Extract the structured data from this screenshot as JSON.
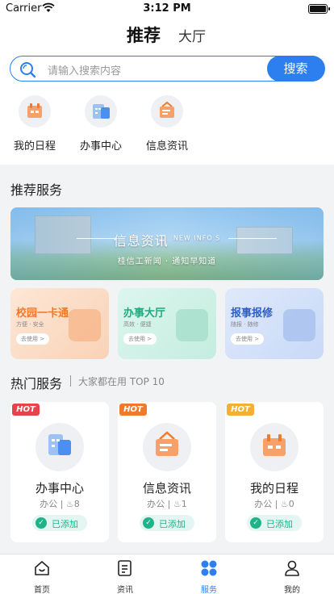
{
  "status": {
    "carrier": "Carrier",
    "time": "3:12 PM"
  },
  "header": {
    "tab_active": "推荐",
    "tab_inactive": "大厅"
  },
  "search": {
    "placeholder": "请输入搜索内容",
    "button": "搜索"
  },
  "quick_links": [
    {
      "label": "我的日程",
      "icon": "calendar-icon"
    },
    {
      "label": "办事中心",
      "icon": "building-icon"
    },
    {
      "label": "信息资讯",
      "icon": "news-icon"
    }
  ],
  "recommend": {
    "title": "推荐服务",
    "banner": {
      "title": "信息资讯",
      "title_badge": "NEW INFO S",
      "subtitle": "桂信工新闻 · 通知早知道"
    },
    "cards": [
      {
        "title": "校园一卡通",
        "subtitle": "方便 · 安全",
        "button": "去使用 >"
      },
      {
        "title": "办事大厅",
        "subtitle": "高效 · 便捷",
        "button": "去使用 >"
      },
      {
        "title": "报事报修",
        "subtitle": "随报 · 随修",
        "button": "去使用 >"
      }
    ]
  },
  "hot": {
    "title": "热门服务",
    "subtitle": "大家都在用 TOP 10",
    "badge_label": "HOT",
    "badge_colors": [
      "#e8434b",
      "#f07a2c",
      "#f2b134"
    ],
    "items": [
      {
        "name": "办事中心",
        "category": "办公",
        "count": "8",
        "status": "已添加",
        "icon": "building-icon"
      },
      {
        "name": "信息资讯",
        "category": "办公",
        "count": "1",
        "status": "已添加",
        "icon": "news-icon"
      },
      {
        "name": "我的日程",
        "category": "办公",
        "count": "0",
        "status": "已添加",
        "icon": "calendar-icon"
      }
    ]
  },
  "tabbar": [
    {
      "label": "首页",
      "icon": "home-icon",
      "active": false
    },
    {
      "label": "资讯",
      "icon": "document-icon",
      "active": false
    },
    {
      "label": "服务",
      "icon": "grid-icon",
      "active": true
    },
    {
      "label": "我的",
      "icon": "person-icon",
      "active": false
    }
  ],
  "colors": {
    "accent": "#2d7ff0",
    "added": "#1fb38a"
  }
}
